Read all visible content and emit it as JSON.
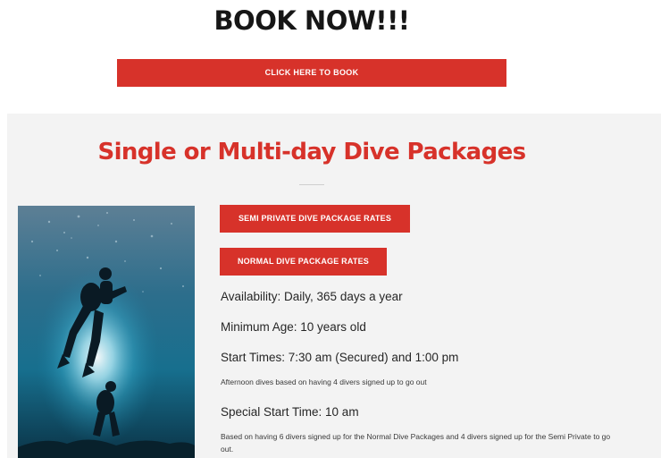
{
  "booking": {
    "title": "BOOK NOW!!!",
    "button_label": "CLICK HERE TO BOOK"
  },
  "packages": {
    "heading": "Single or Multi-day Dive Packages",
    "semi_private_button": "SEMI PRIVATE DIVE PACKAGE RATES",
    "normal_button": "NORMAL DIVE PACKAGE RATES",
    "availability": "Availability: Daily, 365 days a year",
    "minimum_age": "Minimum Age: 10 years old",
    "start_times": "Start Times: 7:30 am (Secured) and 1:00 pm",
    "afternoon_note": "Afternoon dives based on having 4 divers signed up to go out",
    "special_start": "Special Start Time: 10 am",
    "special_note": "Based on having 6 divers signed up for the Normal Dive Packages and 4 divers signed up  for the Semi Private to go out."
  },
  "colors": {
    "accent": "#d7322a",
    "section_bg": "#f3f3f3",
    "title_text": "#161616"
  },
  "images": {
    "photo": "underwater-divers-photo"
  }
}
